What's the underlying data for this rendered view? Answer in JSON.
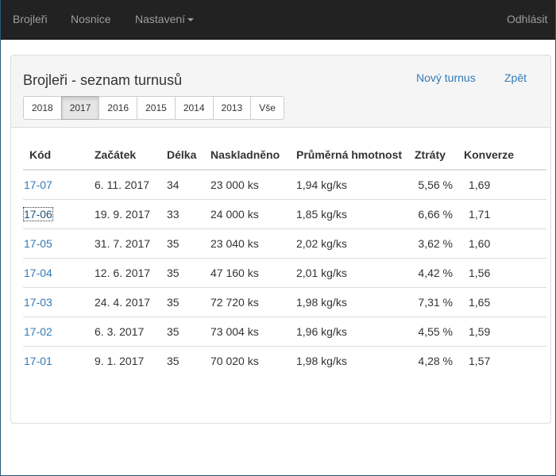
{
  "navbar": {
    "items": [
      {
        "label": "Brojleři"
      },
      {
        "label": "Nosnice"
      },
      {
        "label": "Nastavení"
      }
    ],
    "logout": "Odhlásit"
  },
  "panel": {
    "title": "Brojleři - seznam turnusů",
    "new_link": "Nový turnus",
    "back_link": "Zpět",
    "years": [
      "2018",
      "2017",
      "2016",
      "2015",
      "2014",
      "2013",
      "Vše"
    ],
    "active_year": "2017"
  },
  "table": {
    "headers": [
      "Kód",
      "Začátek",
      "Délka",
      "Naskladněno",
      "Průměrná hmotnost",
      "Ztráty",
      "Konverze"
    ],
    "rows": [
      {
        "code": "17-07",
        "start": "6. 11. 2017",
        "length": "34",
        "stocked": "23 000 ks",
        "weight": "1,94 kg/ks",
        "losses": "5,56 %",
        "conversion": "1,69"
      },
      {
        "code": "17-06",
        "start": "19. 9. 2017",
        "length": "33",
        "stocked": "24 000 ks",
        "weight": "1,85 kg/ks",
        "losses": "6,66 %",
        "conversion": "1,71"
      },
      {
        "code": "17-05",
        "start": "31. 7. 2017",
        "length": "35",
        "stocked": "23 040 ks",
        "weight": "2,02 kg/ks",
        "losses": "3,62 %",
        "conversion": "1,60"
      },
      {
        "code": "17-04",
        "start": "12. 6. 2017",
        "length": "35",
        "stocked": "47 160 ks",
        "weight": "2,01 kg/ks",
        "losses": "4,42 %",
        "conversion": "1,56"
      },
      {
        "code": "17-03",
        "start": "24. 4. 2017",
        "length": "35",
        "stocked": "72 720 ks",
        "weight": "1,98 kg/ks",
        "losses": "7,31 %",
        "conversion": "1,65"
      },
      {
        "code": "17-02",
        "start": "6. 3. 2017",
        "length": "35",
        "stocked": "73 004 ks",
        "weight": "1,96 kg/ks",
        "losses": "4,55 %",
        "conversion": "1,59"
      },
      {
        "code": "17-01",
        "start": "9. 1. 2017",
        "length": "35",
        "stocked": "70 020 ks",
        "weight": "1,98 kg/ks",
        "losses": "4,28 %",
        "conversion": "1,57"
      }
    ]
  },
  "colors": {
    "navbar_bg": "#222222",
    "link": "#337ab7",
    "nav_text": "#9d9d9d"
  }
}
